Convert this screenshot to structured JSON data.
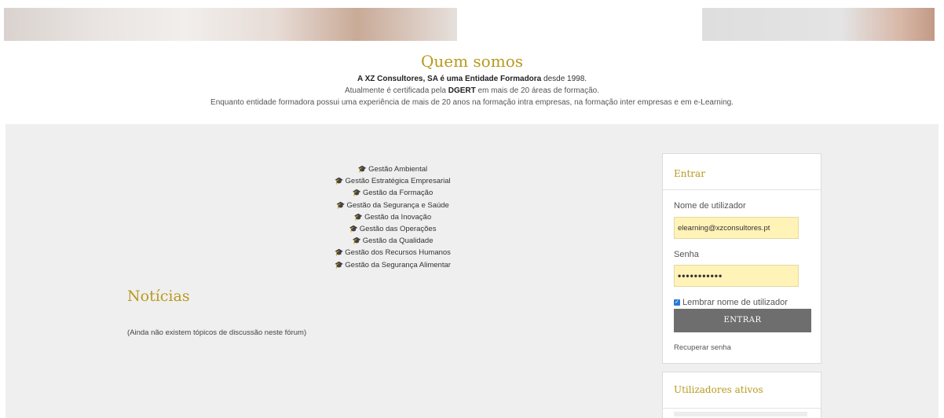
{
  "about": {
    "title": "Quem somos",
    "line1_bold1": "A XZ Consultores, SA é uma  Entidade Formadora",
    "line1_rest": " desde 1998.",
    "line2_pre": "Atualmente é certificada pela ",
    "line2_bold": "DGERT",
    "line2_post": " em mais de 20 áreas de formação.",
    "line3": "Enquanto entidade formadora possui uma experiência de mais de 20 anos na formação intra empresas,  na formação inter empresas e em e-Learning."
  },
  "courses": [
    "Gestão Ambiental",
    "Gestão Estratégica Empresarial",
    "Gestão da Formação",
    "Gestão da Segurança e Saúde",
    "Gestão da Inovação",
    "Gestão das Operações",
    "Gestão da Qualidade",
    "Gestão dos Recursos Humanos",
    "Gestão da Segurança Alimentar"
  ],
  "course_icon": "graduation-cap-icon",
  "news": {
    "title": "Notícias",
    "empty": "(Ainda não existem tópicos de discussão neste fórum)"
  },
  "login": {
    "title": "Entrar",
    "username_label": "Nome de utilizador",
    "username_value": "elearning@xzconsultores.pt",
    "password_label": "Senha",
    "password_value": "•••••••••••",
    "remember_label": "Lembrar nome de utilizador",
    "remember_checked": true,
    "submit_label": "ENTRAR",
    "recover_link": "Recuperar senha"
  },
  "active_users": {
    "title": "Utilizadores ativos"
  },
  "colors": {
    "accent": "#b89a1e",
    "background_grey": "#efefef",
    "input_bg": "#fff3b8",
    "button_bg": "#6e6e6e"
  }
}
